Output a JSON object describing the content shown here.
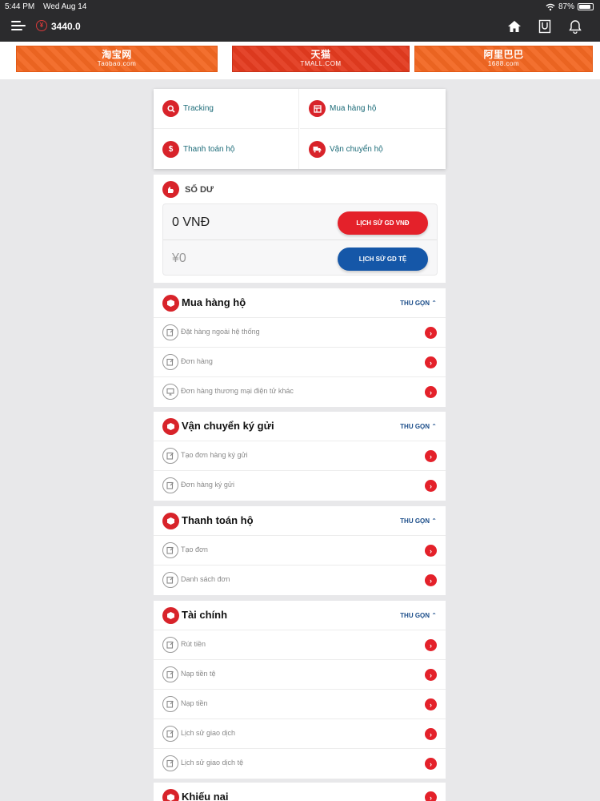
{
  "status_bar": {
    "time": "5:44 PM",
    "date": "Wed Aug 14",
    "battery": "87%",
    "battery_fraction": 0.87
  },
  "header": {
    "balance": "3440.0",
    "coin_symbol": "¥"
  },
  "banners": [
    {
      "title": "淘宝网",
      "subtitle": "Taobao.com"
    },
    {
      "title": "天猫",
      "subtitle": "TMALL.COM"
    },
    {
      "title": "阿里巴巴",
      "subtitle": "1688.com"
    }
  ],
  "quick_actions": [
    {
      "label": "Tracking",
      "icon": "search-icon"
    },
    {
      "label": "Mua hàng hộ",
      "icon": "store-icon"
    },
    {
      "label": "Thanh toán hộ",
      "icon": "dollar-icon"
    },
    {
      "label": "Vận chuyển hộ",
      "icon": "truck-icon"
    }
  ],
  "balance": {
    "title": "SỐ DƯ",
    "vnd_value": "0 VNĐ",
    "cny_value": "¥0",
    "vnd_history_button": "LỊCH SỬ GD VNĐ",
    "cny_history_button": "LỊCH SỬ GD TỆ"
  },
  "collapse_label": "THU GỌN",
  "sections": [
    {
      "title": "Mua hàng hộ",
      "items": [
        "Đặt hàng ngoài hệ thống",
        "Đơn hàng",
        "Đơn hàng thương mại điện tử khác"
      ]
    },
    {
      "title": "Vận chuyển ký gửi",
      "items": [
        "Tạo đơn hàng ký gửi",
        "Đơn hàng ký gửi"
      ]
    },
    {
      "title": "Thanh toán hộ",
      "items": [
        "Tạo đơn",
        "Danh sách đơn"
      ]
    },
    {
      "title": "Tài chính",
      "items": [
        "Rút tiền",
        "Nạp tiền tệ",
        "Nạp tiền",
        "Lịch sử giao dịch",
        "Lịch sử giao dịch tệ"
      ]
    },
    {
      "title": "Khiếu nại",
      "items": []
    }
  ],
  "colors": {
    "accent_red": "#d8232a",
    "button_blue": "#1557a8",
    "link_teal": "#1c6b78",
    "topbar": "#2b2b2d"
  }
}
